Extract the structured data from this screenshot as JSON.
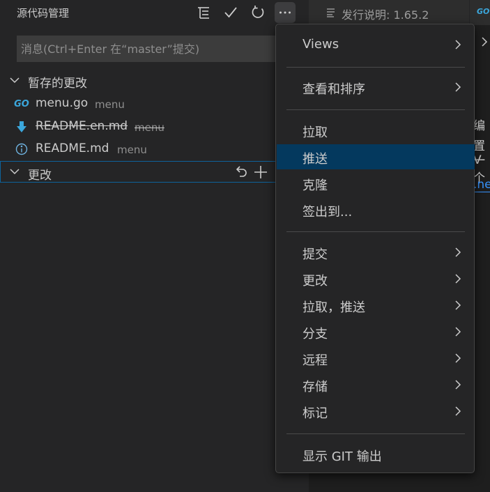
{
  "scm": {
    "title": "源代码管理",
    "message_placeholder": "消息(Ctrl+Enter 在“master”提交)",
    "staged": {
      "label": "暂存的更改",
      "files": [
        {
          "name": "menu.go",
          "dir": "menu",
          "icon": "go-file-icon",
          "icon_text": "GO"
        },
        {
          "name": "README.en.md",
          "dir": "menu",
          "icon": "download-arrow-icon",
          "deleted": true
        },
        {
          "name": "README.md",
          "dir": "menu",
          "icon": "info-icon"
        }
      ]
    },
    "changes": {
      "label": "更改"
    }
  },
  "editor": {
    "tab_release_label": "发行说明: 1.65.2",
    "fragments": [
      "编",
      "置V",
      "一个",
      ".ne"
    ]
  },
  "menu": {
    "items": [
      {
        "label": "Views"
      },
      {
        "label": "查看和排序"
      },
      {
        "label": "拉取"
      },
      {
        "label": "推送"
      },
      {
        "label": "克隆"
      },
      {
        "label": "签出到..."
      },
      {
        "label": "提交"
      },
      {
        "label": "更改"
      },
      {
        "label": "拉取，推送"
      },
      {
        "label": "分支"
      },
      {
        "label": "远程"
      },
      {
        "label": "存储"
      },
      {
        "label": "标记"
      },
      {
        "label": "显示 GIT 输出"
      }
    ]
  },
  "colors": {
    "accent": "#04395e",
    "focus_border": "#0e639c",
    "go_blue": "#3ba7dc"
  }
}
